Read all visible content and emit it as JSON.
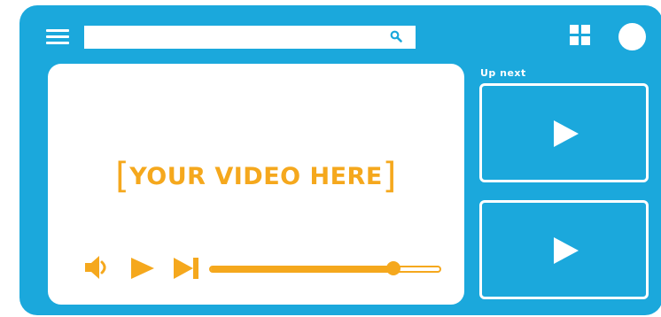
{
  "search": {
    "placeholder": "",
    "value": ""
  },
  "player": {
    "placeholder_text": "YOUR VIDEO HERE",
    "bracket_left": "[",
    "bracket_right": "]",
    "progress_fraction": 0.8
  },
  "sidebar": {
    "up_next_label": "Up next",
    "items": [
      {
        "icon": "play-icon"
      },
      {
        "icon": "play-icon"
      }
    ]
  },
  "icons": {
    "menu": "hamburger-menu-icon",
    "search": "search-icon",
    "apps": "grid-apps-icon",
    "avatar": "avatar",
    "volume": "volume-icon",
    "play": "play-icon",
    "skip": "skip-next-icon"
  },
  "colors": {
    "frame": "#1ba8dc",
    "accent": "#f5a81d",
    "surface": "#ffffff"
  }
}
